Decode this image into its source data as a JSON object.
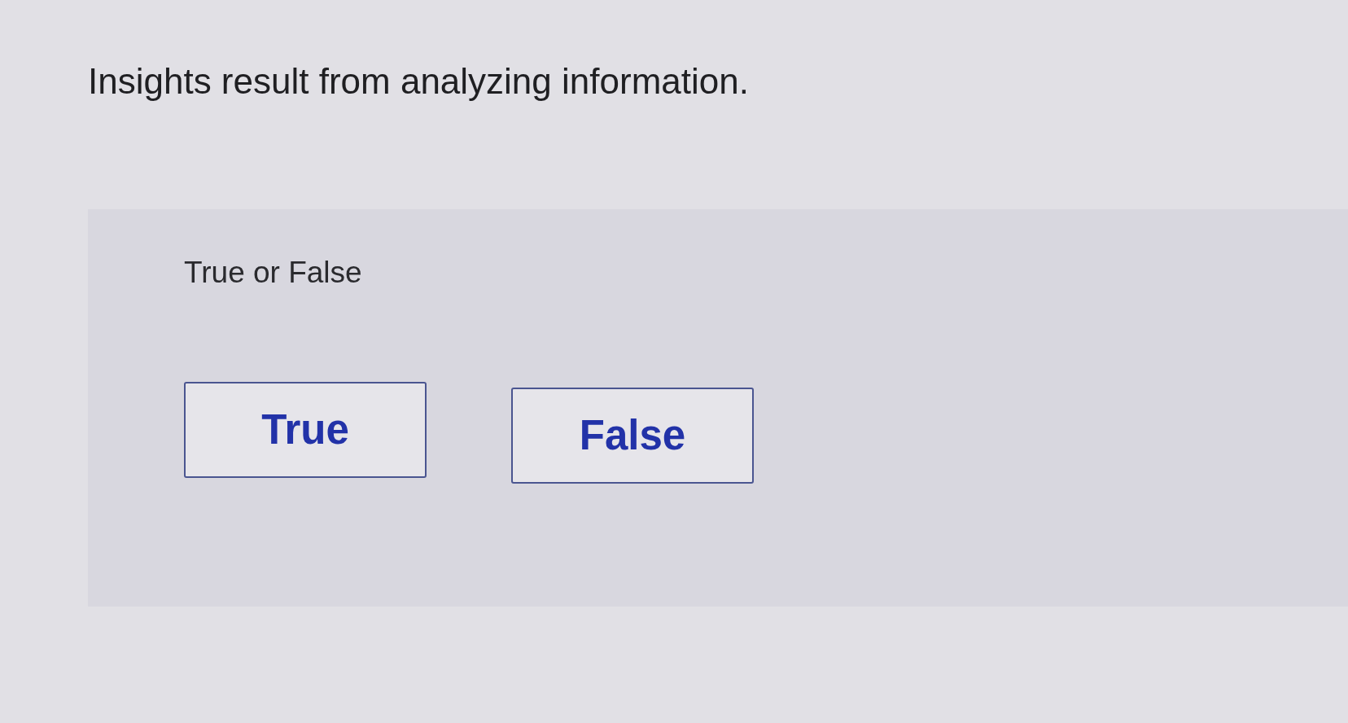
{
  "question": {
    "text": "Insights result from analyzing information."
  },
  "panel": {
    "prompt": "True or False",
    "options": [
      {
        "label": "True",
        "selected": false
      },
      {
        "label": "False",
        "selected": false
      }
    ]
  }
}
